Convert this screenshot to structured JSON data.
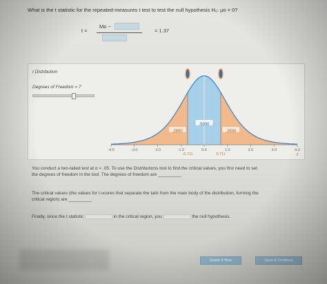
{
  "question": {
    "text": "What is the t statistic for the repeated-measures t test to test the null hypothesis H₀: μᴅ = 0?"
  },
  "formula": {
    "t_label": "t  =",
    "numerator_label": "Mᴅ −",
    "result": "=   1.37"
  },
  "distribution": {
    "title": "t Distribution",
    "dof_label": "Degrees of Freedom = 7",
    "degrees_of_freedom": 7,
    "handle_left_value": -0.711,
    "handle_right_value": 0.711,
    "areas": {
      "left": ".2500",
      "center": ".5000",
      "right": ".2500"
    },
    "tick_labels": [
      "-4.0",
      "-3.0",
      "-2.0",
      "-1.0",
      "0.0",
      "1.0",
      "2.0",
      "3.0",
      "4.0"
    ],
    "axis_label": "t",
    "critical_labels": [
      "-0.711",
      "0.711"
    ],
    "colors": {
      "tail": "#f2b98c",
      "center": "#a8cfe8",
      "curve": "#3c7fbf"
    }
  },
  "instructions": {
    "p1a": "You conduct a two-tailed test at α = .05. To use the Distributions tool to find the critical values, you first need to set",
    "p1b": "the degrees of freedom in the tool. The degrees of freedom are",
    "p2a": "The critical values (the values for t-scores that separate the tails from the main body of the distribution, forming the",
    "p2b": "critical region) are",
    "p3_a": "Finally, since the t statistic",
    "p3_b": "in the critical region, you",
    "p3_c": "the null hypothesis."
  },
  "buttons": {
    "grade": "Grade It Now",
    "save": "Save & Continue"
  }
}
